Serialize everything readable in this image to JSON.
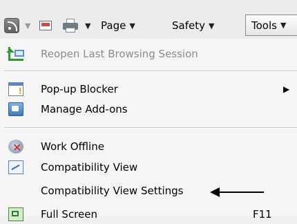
{
  "toolbar": {
    "page_label": "Page",
    "safety_label": "Safety",
    "tools_label": "Tools",
    "icons": [
      "rss-feeds-icon",
      "mail-icon",
      "printer-icon"
    ]
  },
  "menu": {
    "reopen_label": "Reopen Last Browsing Session",
    "popup_blocker_label": "Pop-up Blocker",
    "manage_addons_label": "Manage Add-ons",
    "work_offline_label": "Work Offline",
    "compat_view_label": "Compatibility View",
    "compat_settings_label": "Compatibility View Settings",
    "full_screen_label": "Full Screen",
    "full_screen_shortcut": "F11"
  },
  "colors": {
    "menu_background": "#f5f5f5",
    "disabled_text": "#8b8b8b",
    "annotation_arrow": "#000000"
  }
}
